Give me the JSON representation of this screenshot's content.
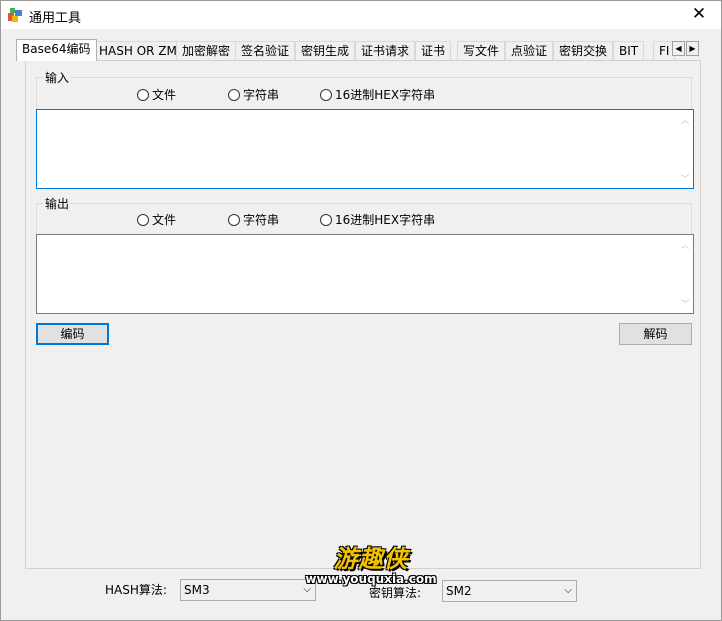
{
  "window": {
    "title": "通用工具",
    "close_glyph": "✕"
  },
  "tabs": {
    "items": [
      {
        "label": "Base64编码",
        "active": true
      },
      {
        "label": "HASH OR ZM"
      },
      {
        "label": "加密解密"
      },
      {
        "label": "签名验证"
      },
      {
        "label": "密钥生成"
      },
      {
        "label": "证书请求"
      },
      {
        "label": "证书"
      },
      {
        "label": "写文件"
      },
      {
        "label": "点验证"
      },
      {
        "label": "密钥交换"
      },
      {
        "label": "BIT"
      },
      {
        "label": "FI"
      }
    ],
    "scroll_left": "◀",
    "scroll_right": "▶"
  },
  "input_group": {
    "label": "输入",
    "options": [
      "文件",
      "字符串",
      "16进制HEX字符串"
    ]
  },
  "output_group": {
    "label": "输出",
    "options": [
      "文件",
      "字符串",
      "16进制HEX字符串"
    ]
  },
  "scroll_glyphs": {
    "up": "︿",
    "down": "﹀"
  },
  "actions": {
    "encode": "编码",
    "decode": "解码"
  },
  "footer": {
    "hash_label": "HASH算法:",
    "hash_value": "SM3",
    "key_label": "密钥算法:",
    "key_value": "SM2",
    "dropdown_glyph": "⌵"
  },
  "watermark": {
    "cn": "游趣侠",
    "url": "www.youquxia.com"
  }
}
